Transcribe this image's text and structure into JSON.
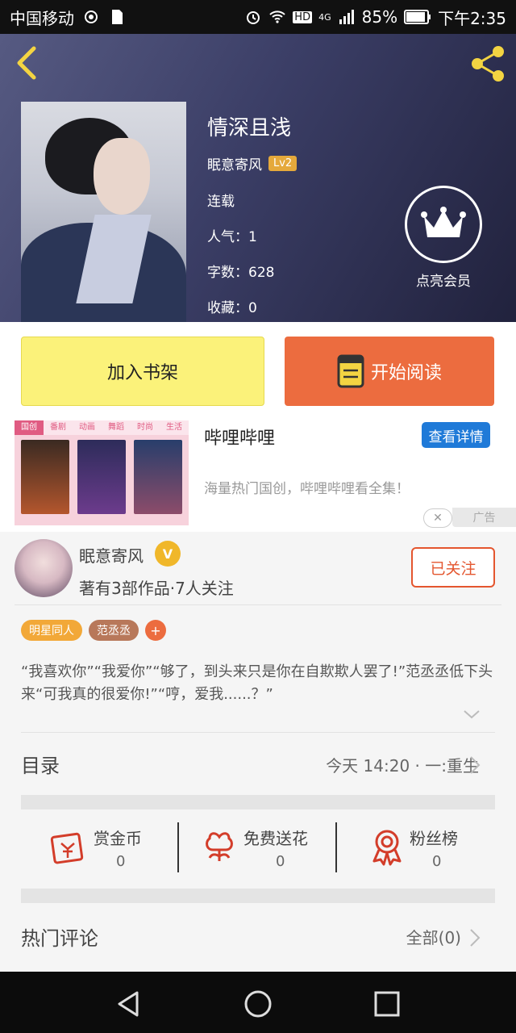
{
  "status_bar": {
    "carrier": "中国移动",
    "network": "HD",
    "signal": "4G",
    "battery": "85%",
    "time": "下午2:35"
  },
  "book": {
    "title": "情深且浅",
    "author": "眠意寄风",
    "level": "Lv2",
    "status": "连载",
    "popularity": "人气：1",
    "word_count": "字数：628",
    "favorites": "收藏：0",
    "vip_label": "点亮会员"
  },
  "buttons": {
    "add_shelf": "加入书架",
    "start_read": "开始阅读"
  },
  "ad": {
    "tabs": [
      "国创",
      "番剧",
      "动画",
      "舞蹈",
      "时尚",
      "生活"
    ],
    "title": "哔哩哔哩",
    "detail_button": "查看详情",
    "description": "海量热门国创，哔哩哔哩看全集！",
    "close": "✕",
    "tag": "广告"
  },
  "author_info": {
    "name": "眠意寄风",
    "badge": "V",
    "stats": "著有3部作品·7人关注",
    "follow_button": "已关注"
  },
  "tags": [
    {
      "label": "明星同人",
      "color": "#f2a838"
    },
    {
      "label": "范丞丞",
      "color": "#b8785a"
    }
  ],
  "tag_add": "+",
  "synopsis": "“我喜欢你”“我爱你”“够了，到头来只是你在自欺欺人罢了!”范丞丞低下头来“可我真的很爱你!”“哼，爱我......？”",
  "toc": {
    "label": "目录",
    "latest": "今天 14:20 · 一:重生"
  },
  "actions": [
    {
      "label": "赏金币",
      "count": "0",
      "icon": "gold-coin-icon"
    },
    {
      "label": "免费送花",
      "count": "0",
      "icon": "flower-icon"
    },
    {
      "label": "粉丝榜",
      "count": "0",
      "icon": "medal-icon"
    }
  ],
  "comments": {
    "label": "热门评论",
    "all": "全部(0)"
  },
  "colors": {
    "accent_orange": "#ec6c3f",
    "shelf_yellow": "#fbf27a",
    "follow_red": "#e4562f",
    "ad_blue": "#1f7ad8"
  }
}
